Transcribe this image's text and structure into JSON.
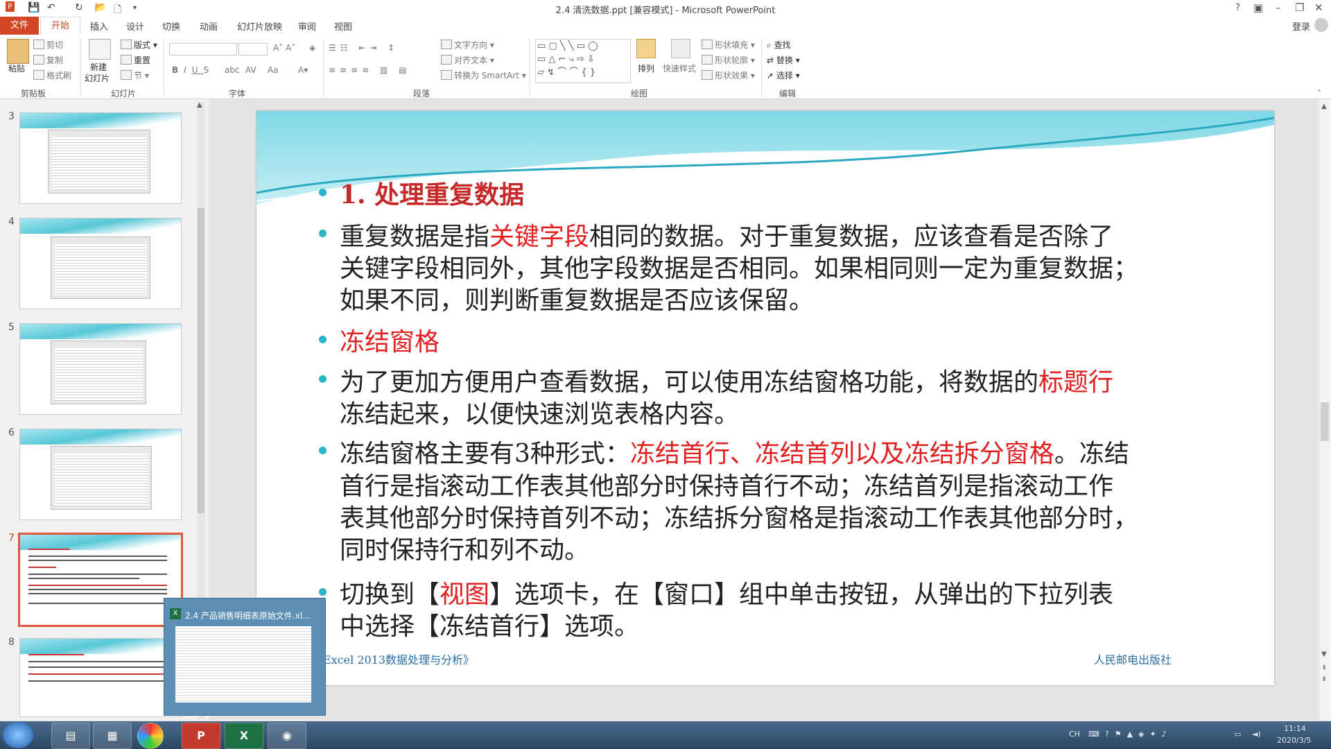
{
  "window": {
    "title": "2.4 清洗数据.ppt [兼容模式] - Microsoft PowerPoint",
    "help": "?",
    "login": "登录"
  },
  "tabs": [
    "文件",
    "开始",
    "插入",
    "设计",
    "切换",
    "动画",
    "幻灯片放映",
    "审阅",
    "视图"
  ],
  "ribbon": {
    "clipboard": {
      "paste": "粘贴",
      "cut": "剪切",
      "copy": "复制",
      "painter": "格式刷",
      "label": "剪贴板"
    },
    "slides": {
      "new": "新建",
      "new2": "幻灯片",
      "layout": "版式",
      "reset": "重置",
      "section": "节",
      "label": "幻灯片"
    },
    "font": {
      "label": "字体"
    },
    "paragraph": {
      "direction": "文字方向",
      "align": "对齐文本",
      "smartart": "转换为 SmartArt",
      "label": "段落"
    },
    "drawing": {
      "arrange": "排列",
      "quick": "快速样式",
      "fill": "形状填充",
      "outline": "形状轮廓",
      "effect": "形状效果",
      "label": "绘图"
    },
    "editing": {
      "find": "查找",
      "replace": "替换",
      "select": "选择",
      "label": "编辑"
    }
  },
  "thumbnails": [
    "3",
    "4",
    "5",
    "6",
    "7",
    "8"
  ],
  "slide": {
    "h1": "1.  处理重复数据",
    "p1a": "重复数据是指",
    "p1b": "关键字段",
    "p1c": "相同的数据。对于重复数据，应该查看是否除了",
    "p1d": "关键字段相同外，其他字段数据是否相同。如果相同则一定为重复数据；",
    "p1e": "如果不同，则判断重复数据是否应该保留。",
    "h2": "冻结窗格",
    "p2a": "为了更加方便用户查看数据，可以使用冻结窗格功能，将数据的",
    "p2b": "标题行",
    "p2c": "冻结起来，以便快速浏览表格内容。",
    "p3a": "冻结窗格主要有3种形式：",
    "p3b": "冻结首行、冻结首列以及冻结拆分窗格",
    "p3c": "。冻结",
    "p3d": "首行是指滚动工作表其他部分时保持首行不动；冻结首列是指滚动工作",
    "p3e": "表其他部分时保持首列不动；冻结拆分窗格是指滚动工作表其他部分时，",
    "p3f": "同时保持行和列不动。",
    "p4a": "切换到【",
    "p4b": "视图",
    "p4c": "】选项卡，在【窗口】组中单击按钮，从弹出的下拉列表",
    "p4d": "中选择【冻结首行】选项。",
    "footer_left": "Excel 2013数据处理与分析》",
    "footer_right": "人民邮电出版社"
  },
  "preview": {
    "title": "2.4 产品销售明细表原始文件.xl..."
  },
  "taskbar": {
    "time": "11:14",
    "date": "2020/3/5",
    "ime": "CH"
  }
}
